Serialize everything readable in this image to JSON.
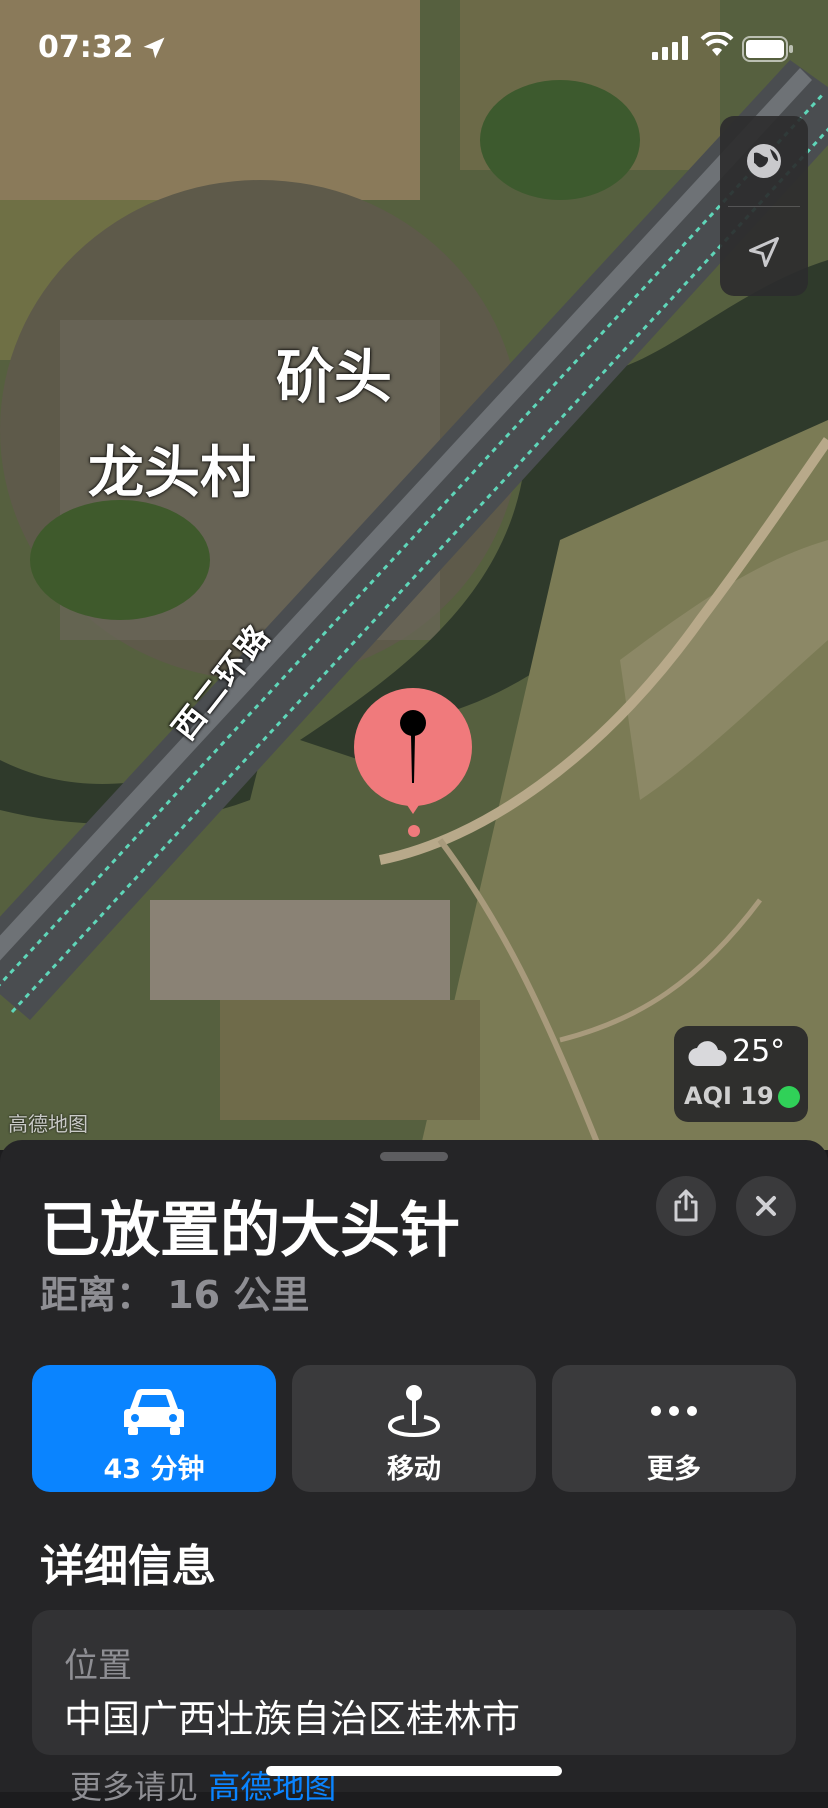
{
  "status_bar": {
    "time": "07:32"
  },
  "map": {
    "labels": {
      "place_1": "砎头",
      "place_2": "龙头村",
      "road": "西二环路"
    },
    "attribution": "高德地图",
    "weather": {
      "temperature": "25°",
      "aqi": "AQI 19",
      "aqi_color": "#30d158"
    }
  },
  "sheet": {
    "title": "已放置的大头针",
    "distance": "距离： 16 公里",
    "actions": {
      "drive": {
        "label": "43 分钟",
        "icon": "car-icon"
      },
      "move": {
        "label": "移动",
        "icon": "move-pin-icon"
      },
      "more": {
        "label": "更多",
        "icon": "ellipsis-icon"
      }
    },
    "details_heading": "详细信息",
    "location": {
      "key": "位置",
      "value": "中国广西壮族自治区桂林市"
    },
    "see_more": {
      "prefix": "更多请见",
      "link": "高德地图"
    }
  },
  "colors": {
    "accent": "#0a84ff",
    "pin": "#f07a7c",
    "sheet_bg": "#252527"
  }
}
